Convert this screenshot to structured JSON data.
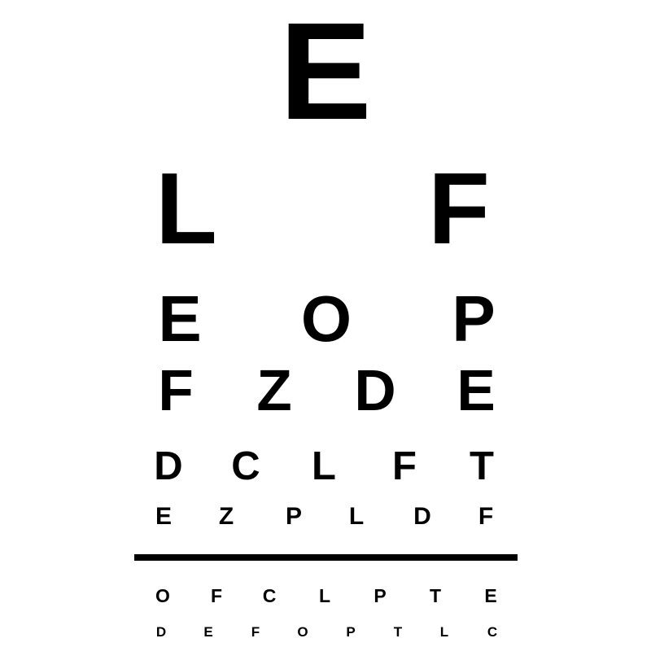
{
  "rows": [
    {
      "letters": [
        "E"
      ]
    },
    {
      "letters": [
        "L",
        "F"
      ]
    },
    {
      "letters": [
        "E",
        "O",
        "P"
      ]
    },
    {
      "letters": [
        "F",
        "Z",
        "D",
        "E"
      ]
    },
    {
      "letters": [
        "D",
        "C",
        "L",
        "F",
        "T"
      ]
    },
    {
      "letters": [
        "E",
        "Z",
        "P",
        "L",
        "D",
        "F"
      ]
    },
    {
      "letters": [
        "O",
        "F",
        "C",
        "L",
        "P",
        "T",
        "E"
      ]
    },
    {
      "letters": [
        "D",
        "E",
        "F",
        "O",
        "P",
        "T",
        "L",
        "C"
      ]
    }
  ],
  "colors": {
    "background": "#ffffff",
    "ink": "#000000"
  }
}
